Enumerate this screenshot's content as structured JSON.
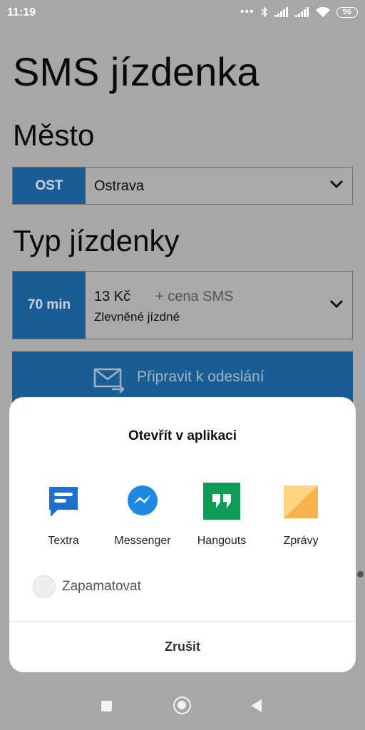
{
  "status_bar": {
    "time": "11:19",
    "battery": "96",
    "icons": [
      "dots-icon",
      "bluetooth-icon",
      "signal-icon",
      "signal-icon",
      "wifi-icon",
      "battery-icon"
    ]
  },
  "app": {
    "title": "SMS jízdenka",
    "city_section": {
      "title": "Město",
      "code": "OST",
      "value": "Ostrava"
    },
    "ticket_section": {
      "title": "Typ jízdenky",
      "duration": "70 min",
      "price": "13 Kč",
      "price_extra": "+ cena SMS",
      "description": "Zlevněné jízdné"
    },
    "prepare_button": {
      "label": "Připravit k odeslání",
      "icon": "envelope-send-icon"
    }
  },
  "dialog": {
    "title": "Otevřít v aplikaci",
    "apps": [
      {
        "name": "Textra",
        "icon": "textra-icon"
      },
      {
        "name": "Messenger",
        "icon": "messenger-icon"
      },
      {
        "name": "Hangouts",
        "icon": "hangouts-icon"
      },
      {
        "name": "Zprávy",
        "icon": "messages-icon"
      }
    ],
    "remember_label": "Zapamatovat",
    "remember_checked": false,
    "cancel_label": "Zrušit"
  },
  "colors": {
    "accent": "#1a5d95",
    "scrim": "#a7a7a7",
    "sheet": "#ffffff"
  }
}
